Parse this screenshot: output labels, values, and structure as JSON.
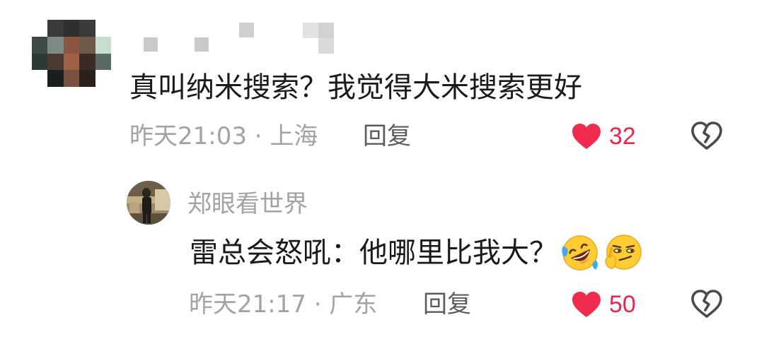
{
  "comment": {
    "text": "真叫纳米搜索？我觉得大米搜索更好",
    "meta": "昨天21:03 · 上海",
    "reply_label": "回复",
    "likes": "32"
  },
  "reply": {
    "author": "郑眼看世界",
    "text": "雷总会怒吼：他哪里比我大？",
    "emojis": [
      "rolling-on-floor-laughing-icon",
      "smirking-thinking-face-icon"
    ],
    "meta": "昨天21:17 · 广东",
    "reply_label": "回复",
    "likes": "50"
  },
  "colors": {
    "like_red": "#f02b4e",
    "muted_text": "#a3a3a3",
    "body_text": "#1a1a1a"
  }
}
